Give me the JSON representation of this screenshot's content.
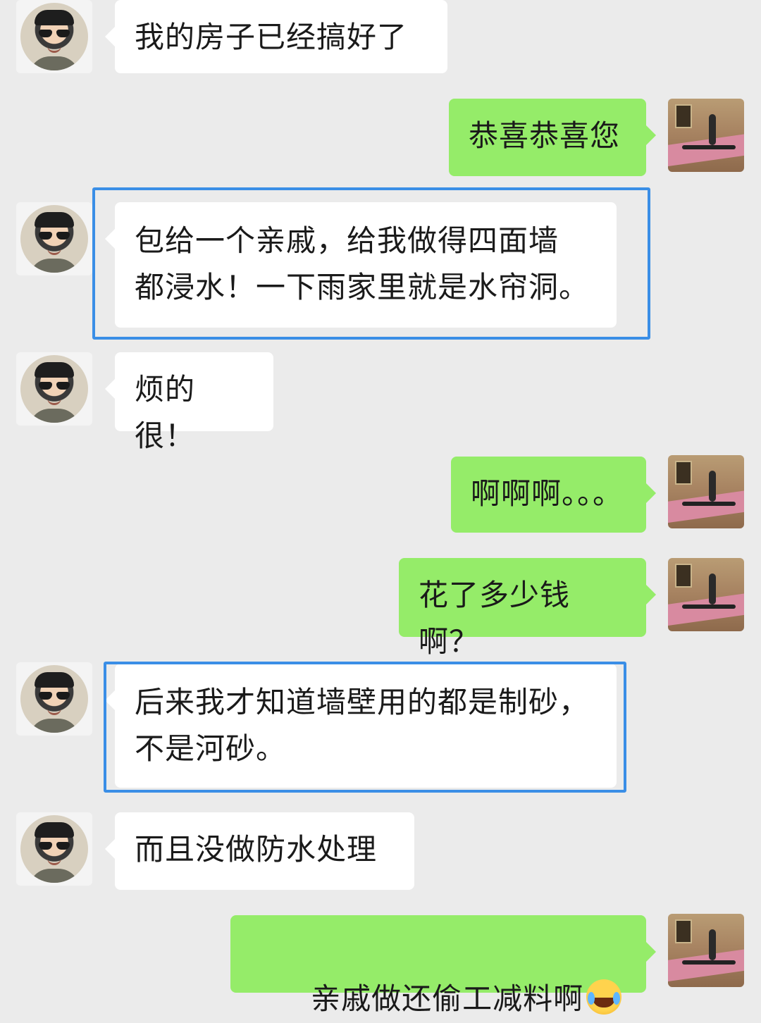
{
  "chat": {
    "messages": [
      {
        "side": "left",
        "text": "我的房子已经搞好了"
      },
      {
        "side": "right",
        "text": "恭喜恭喜您"
      },
      {
        "side": "left",
        "text": "包给一个亲戚，给我做得四面墙\n都浸水！一下雨家里就是水帘洞。",
        "highlighted": true
      },
      {
        "side": "left",
        "text": "烦的很！"
      },
      {
        "side": "right",
        "text": "啊啊啊。。。"
      },
      {
        "side": "right",
        "text": "花了多少钱啊？"
      },
      {
        "side": "left",
        "text": "后来我才知道墙壁用的都是制砂，\n不是河砂。",
        "highlighted": true
      },
      {
        "side": "left",
        "text": "而且没做防水处理"
      },
      {
        "side": "right",
        "text": "亲戚做还偷工减料啊",
        "emojis": [
          "crying-laughing-emoji",
          "crying-laughing-emoji"
        ]
      }
    ]
  },
  "colors": {
    "background": "#ebebeb",
    "incoming_bubble": "#ffffff",
    "outgoing_bubble": "#95ec69",
    "highlight_border": "#3a8ee6"
  }
}
